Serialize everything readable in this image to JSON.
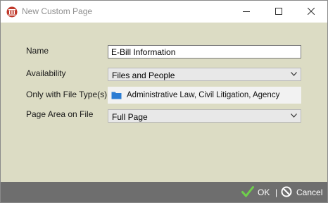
{
  "window": {
    "title": "New Custom Page",
    "accent_color": "#c0392b"
  },
  "form": {
    "name_label": "Name",
    "name_value": "E-Bill Information",
    "availability_label": "Availability",
    "availability_value": "Files and People",
    "file_types_label": "Only with File Type(s)",
    "file_types_value": "Administrative Law, Civil Litigation, Agency",
    "page_area_label": "Page Area on File",
    "page_area_value": "Full Page"
  },
  "footer": {
    "ok_label": "OK",
    "separator": "|",
    "cancel_label": "Cancel",
    "ok_color": "#6fcf4b"
  },
  "icons": {
    "app": "courthouse-icon",
    "folder": "folder-icon",
    "ok": "checkmark-icon",
    "cancel": "prohibited-icon"
  }
}
